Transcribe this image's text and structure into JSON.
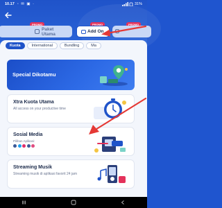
{
  "status_bar": {
    "time": "10.17",
    "system_icons": "◦ ✉ ▣ ·",
    "signal_icon": "signal-icon",
    "battery": "31%"
  },
  "header": {
    "back_icon": "back-arrow-icon"
  },
  "top_tabs": [
    {
      "label": "Paket Utama",
      "badge": "PROMO",
      "active": false
    },
    {
      "label": "Add On",
      "badge": "PROMO",
      "active": true
    },
    {
      "label": "",
      "badge": "PROMO",
      "active": false
    }
  ],
  "chips": [
    {
      "label": "Kuota",
      "active": true
    },
    {
      "label": "International",
      "active": false
    },
    {
      "label": "Bundling",
      "active": false
    },
    {
      "label": "Ma",
      "active": false
    }
  ],
  "cards": {
    "dikotamu": {
      "title": "Special Dikotamu"
    },
    "xtra": {
      "title": "Xtra Kuota Utama",
      "desc": "All access on your productive time"
    },
    "sosmed": {
      "title": "Sosial Media",
      "apps_label": "Pilihan Aplikasi:"
    },
    "musik": {
      "title": "Streaming Musik",
      "desc": "Streaming musik di aplikasi favorit 24 jam"
    }
  },
  "nav_bar": {
    "back": "◁",
    "home": "○",
    "recents": "□"
  },
  "colors": {
    "primary": "#1f53c9",
    "promo_badge": "#e4325b",
    "annotation_arrow": "#e53935"
  }
}
